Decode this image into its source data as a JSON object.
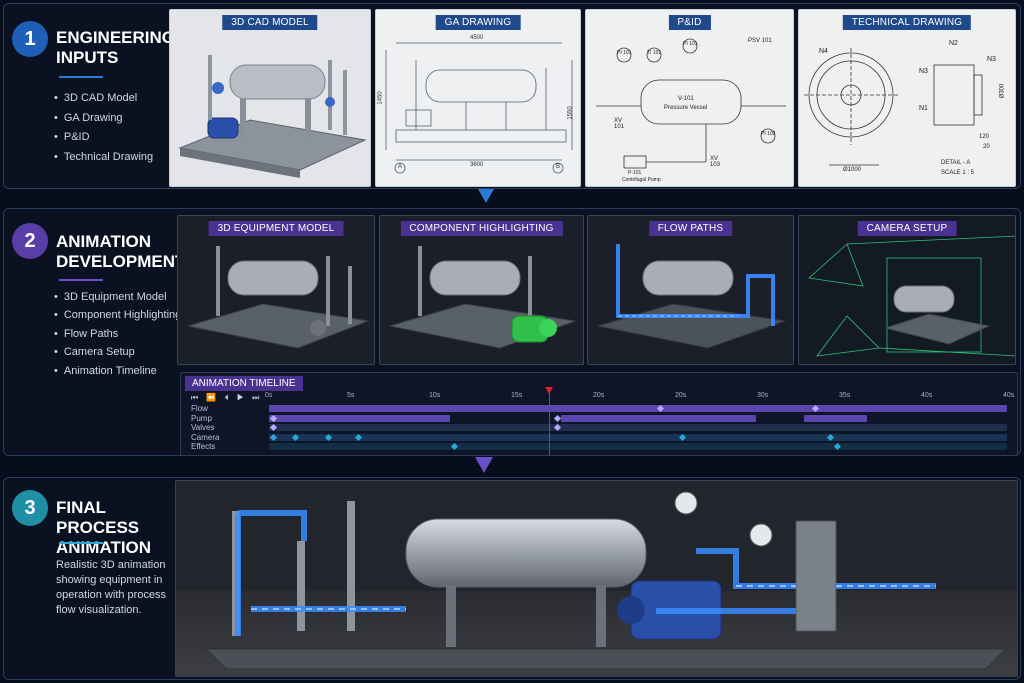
{
  "colors": {
    "step1": "#1f5fb8",
    "step2": "#5a3ea8",
    "step3": "#1f8fa5",
    "flow_blue": "#3a8cff",
    "highlight_green": "#2fbf4a",
    "timeline_purple": "#6b4fc8",
    "timeline_cyan": "#2aa7d6",
    "playhead_red": "#e02424"
  },
  "sections": {
    "inputs": {
      "number": "1",
      "title_line1": "ENGINEERING",
      "title_line2": "INPUTS",
      "bullets": [
        "3D CAD Model",
        "GA Drawing",
        "P&ID",
        "Technical Drawing"
      ],
      "panels": [
        "3D CAD MODEL",
        "GA DRAWING",
        "P&ID",
        "TECHNICAL DRAWING"
      ]
    },
    "animation": {
      "number": "2",
      "title_line1": "ANIMATION",
      "title_line2": "DEVELOPMENT",
      "bullets": [
        "3D Equipment Model",
        "Component Highlighting",
        "Flow Paths",
        "Camera Setup",
        "Animation Timeline"
      ],
      "panels": [
        "3D EQUIPMENT MODEL",
        "COMPONENT HIGHLIGHTING",
        "FLOW PATHS",
        "CAMERA SETUP"
      ]
    },
    "final": {
      "number": "3",
      "title_line1": "FINAL PROCESS",
      "title_line2": "ANIMATION",
      "description": "Realistic 3D animation showing equipment in operation with process flow visualization."
    }
  },
  "drawings": {
    "ga": {
      "width_dim": "4500",
      "base_dim": "3600",
      "height_dim": "1450",
      "side_dim": "1550",
      "ref_a": "A",
      "ref_b": "B"
    },
    "pid": {
      "instruments": [
        "PI 101",
        "TI 101",
        "PI 101",
        "PSV 101",
        "PI 102",
        "XV 101",
        "XV 103"
      ],
      "vessel_tag": "V-101",
      "vessel_name": "Pressure Vessel",
      "pump_tag": "P-101",
      "pump_name": "Centrifugal Pump"
    },
    "technical": {
      "nozzles": [
        "N1",
        "N2",
        "N3",
        "N3",
        "N4"
      ],
      "diameter": "Ø1000",
      "dim_300": "Ø300",
      "dim_120": "120",
      "dim_20": "20",
      "detail": "DETAIL - A",
      "scale": "SCALE 1 : 5"
    }
  },
  "timeline": {
    "title": "ANIMATION TIMELINE",
    "controls": "⏮ ⏪ ⏴ ▶ ⏭",
    "ticks": [
      "0s",
      "5s",
      "10s",
      "15s",
      "20s",
      "20s",
      "30s",
      "35s",
      "40s",
      "40s"
    ],
    "tracks": [
      "Flow",
      "Pump",
      "Valves",
      "Camera",
      "Effects"
    ],
    "playhead_fraction": 0.38
  }
}
